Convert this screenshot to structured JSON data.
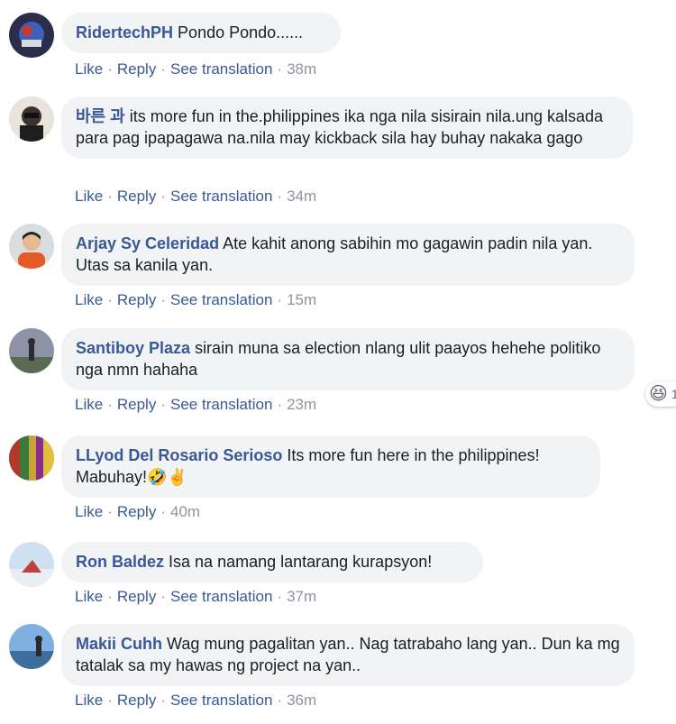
{
  "actions": {
    "like": "Like",
    "reply": "Reply",
    "see_translation": "See translation",
    "separator": "·"
  },
  "comments": [
    {
      "author": "RidertechPH",
      "text": "Pondo Pondo......",
      "time": "38m"
    },
    {
      "author": "바른 과",
      "text": "its more fun in the.philippines ika nga nila sisirain nila.ung kalsada para pag ipapagawa na.nila may kickback sila hay buhay nakaka gago",
      "time": "34m"
    },
    {
      "author": "Arjay Sy Celeridad",
      "text": "Ate kahit anong sabihin mo gagawin padin nila yan. Utas sa kanila yan.",
      "time": "15m"
    },
    {
      "author": "Santiboy Plaza",
      "text": "sirain muna sa election nlang ulit paayos hehehe politiko nga nmn hahaha",
      "time": "23m",
      "reaction": {
        "emoji": "😆",
        "count": "1"
      }
    },
    {
      "author": "LLyod Del Rosario Serioso",
      "text": "Its more fun here in the philippines! Mabuhay!",
      "emoji": "🤣✌️",
      "time": "40m"
    },
    {
      "author": "Ron Baldez",
      "text": "Isa na namang lantarang kurapsyon!",
      "time": "37m"
    },
    {
      "author": "Makii Cuhh",
      "text": "Wag mung pagalitan yan.. Nag tatrabaho lang yan.. Dun ka mg tatalak sa my hawas ng project na yan..",
      "time": "36m"
    }
  ]
}
